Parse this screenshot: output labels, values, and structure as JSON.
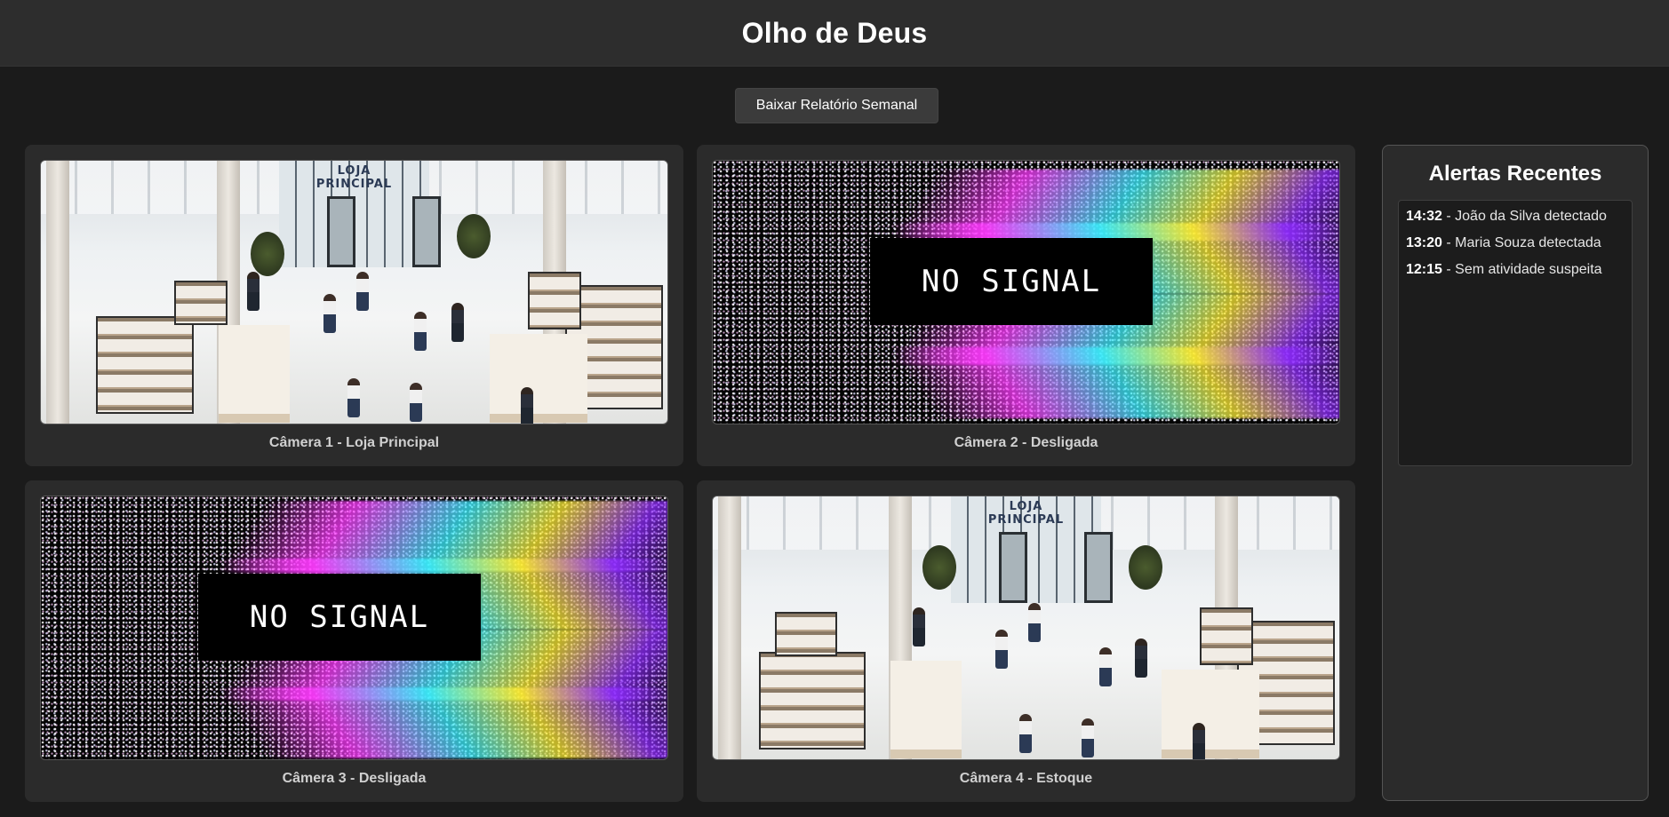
{
  "app": {
    "title": "Olho de Deus"
  },
  "toolbar": {
    "report_button_label": "Baixar Relatório Semanal"
  },
  "cameras": [
    {
      "label": "Câmera 1 - Loja Principal",
      "status": "live",
      "scene_sign": "LOJA PRINCIPAL"
    },
    {
      "label": "Câmera 2 - Desligada",
      "status": "offline",
      "overlay_text": "NO SIGNAL"
    },
    {
      "label": "Câmera 3 - Desligada",
      "status": "offline",
      "overlay_text": "NO SIGNAL"
    },
    {
      "label": "Câmera 4 - Estoque",
      "status": "live",
      "scene_sign": "LOJA PRINCIPAL"
    }
  ],
  "alerts": {
    "title": "Alertas Recentes",
    "items": [
      {
        "time": "14:32",
        "text": " - João da Silva detectado"
      },
      {
        "time": "13:20",
        "text": " - Maria Souza detectada"
      },
      {
        "time": "12:15",
        "text": " - Sem atividade suspeita"
      }
    ]
  },
  "colors": {
    "background": "#1b1b1b",
    "header": "#2d2d2d",
    "card": "#2b2b2b",
    "button": "#3b3b3b"
  }
}
